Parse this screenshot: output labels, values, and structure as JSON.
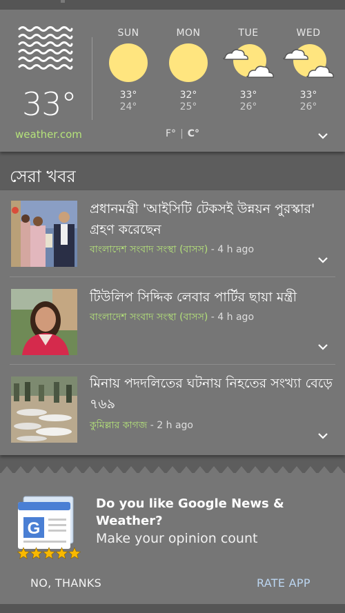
{
  "weather": {
    "current_temp": "33°",
    "current_icon": "haze-icon",
    "days": [
      {
        "name": "SUN",
        "high": "33°",
        "low": "24°",
        "icon": "sun-icon"
      },
      {
        "name": "MON",
        "high": "32°",
        "low": "25°",
        "icon": "sun-icon"
      },
      {
        "name": "TUE",
        "high": "33°",
        "low": "26°",
        "icon": "partly-cloudy-icon"
      },
      {
        "name": "WED",
        "high": "33°",
        "low": "26°",
        "icon": "partly-cloudy-icon"
      }
    ],
    "source": "weather.com",
    "unit_f": "F°",
    "unit_sep": "|",
    "unit_c": "C°",
    "active_unit": "C°"
  },
  "top_stories": {
    "title": "সেরা খবর",
    "items": [
      {
        "headline": "প্রধানমন্ত্রী 'আইসিটি টেকসই উন্নয়ন পুরস্কার' গ্রহণ করেছেন",
        "source": "বাংলাদেশ সংবাদ সংস্থা (বাসস)",
        "time": " - 4 h ago"
      },
      {
        "headline": "টিউলিপ সিদ্দিক লেবার পার্টির ছায়া মন্ত্রী",
        "source": "বাংলাদেশ সংবাদ সংস্থা (বাসস)",
        "time": " - 4 h ago"
      },
      {
        "headline": "মিনায় পদদলিতের ঘটনায় নিহতের সংখ্যা বেড়ে ৭৬৯",
        "source": "কুমিল্লার কাগজ",
        "time": " - 2 h ago"
      }
    ]
  },
  "rate_card": {
    "question": "Do you like Google News & Weather?",
    "subtitle": "Make your opinion count",
    "stars": 5,
    "no_label": "NO, THANKS",
    "yes_label": "RATE APP"
  },
  "colors": {
    "accent_green": "#b5e37a",
    "button_blue": "#bcd6f1",
    "sun_yellow": "#ffe57f",
    "star_gold": "#f9b900"
  }
}
